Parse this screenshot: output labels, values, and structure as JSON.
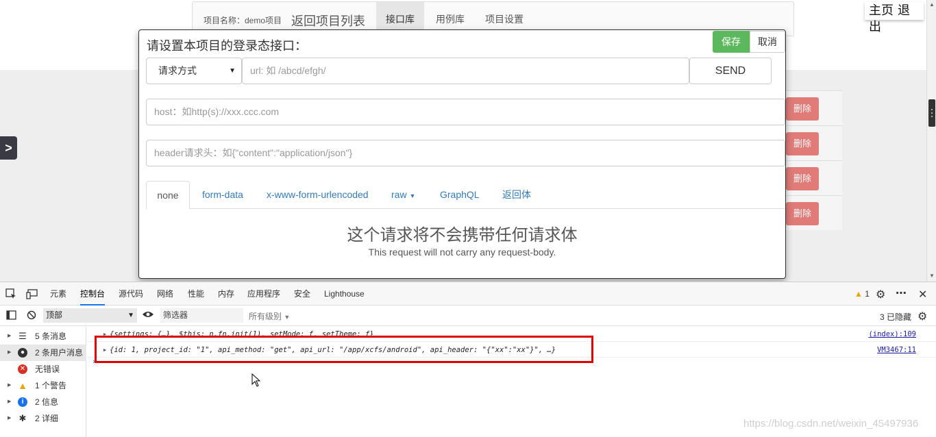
{
  "topnav": {
    "project_label": "项目名称：demo项目",
    "back_link": "返回项目列表",
    "tabs": [
      "接口库",
      "用例库",
      "项目设置"
    ]
  },
  "header_links": {
    "home": "主页",
    "logout": "退出"
  },
  "side_toggle": ">",
  "background_table": {
    "delete_label": "删除"
  },
  "modal": {
    "title": "请设置本项目的登录态接口：",
    "save_label": "保存",
    "cancel_label": "取消",
    "method_select": "请求方式",
    "url_placeholder": "url: 如 /abcd/efgh/",
    "send_label": "SEND",
    "host_placeholder": "host：如http(s)://xxx.ccc.com",
    "header_placeholder": "header请求头：如{\"content\":\"application/json\"}",
    "body_tabs": [
      "none",
      "form-data",
      "x-www-form-urlencoded",
      "raw",
      "GraphQL",
      "返回体"
    ],
    "no_body_cn": "这个请求将不会携带任何请求体",
    "no_body_en": "This request will not carry any request-body."
  },
  "devtools": {
    "tabs": [
      "元素",
      "控制台",
      "源代码",
      "网络",
      "性能",
      "内存",
      "应用程序",
      "安全",
      "Lighthouse"
    ],
    "active_tab": "控制台",
    "warning_count": "1",
    "context": "顶部",
    "filter_placeholder": "筛选器",
    "levels": "所有级别",
    "hidden": "3 已隐藏",
    "sidebar": [
      {
        "label": "5 条消息",
        "icon": "list-icon"
      },
      {
        "label": "2 条用户消息",
        "icon": "user-icon"
      },
      {
        "label": "无错误",
        "icon": "error-icon"
      },
      {
        "label": "1 个警告",
        "icon": "warning-icon"
      },
      {
        "label": "2 信息",
        "icon": "info-icon"
      },
      {
        "label": "2 详细",
        "icon": "bug-icon"
      }
    ],
    "logs": [
      {
        "text": "{settings: {…}, $this: n.fn.init(1), setMode: ƒ, setTheme: ƒ}",
        "source": "(index):109"
      },
      {
        "text": "{id: 1, project_id: \"1\", api_method: \"get\", api_url: \"/app/xcfs/android\", api_header: \"{\"xx\":\"xx\"}\", …}",
        "source": "VM3467:11"
      }
    ]
  },
  "watermark": "https://blog.csdn.net/weixin_45497936",
  "colors": {
    "save": "#5cb85c",
    "delete": "#d9534f",
    "link": "#337ab7",
    "highlight": "#e00000"
  }
}
